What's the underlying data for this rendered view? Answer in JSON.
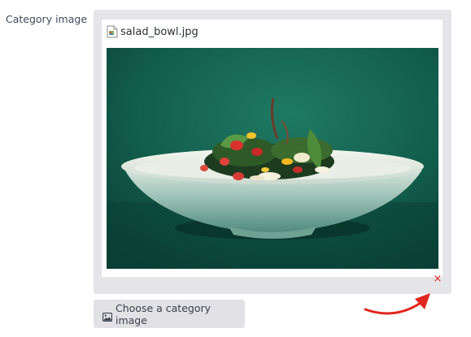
{
  "field": {
    "label": "Category image"
  },
  "preview": {
    "file_name": "salad_bowl.jpg",
    "file_icon": "broken-image-icon",
    "image_alt": "Salad in a white bowl on a green background",
    "remove_symbol": "×"
  },
  "choose_button": {
    "label": "Choose a category image",
    "icon": "image-icon"
  },
  "annotation": {
    "arrow_color": "#e0261f"
  },
  "colors": {
    "panel_bg": "#e5e4e9",
    "button_bg": "#e2e1e6",
    "remove": "#e0261f",
    "photo_bg": "#0f5b4a"
  }
}
